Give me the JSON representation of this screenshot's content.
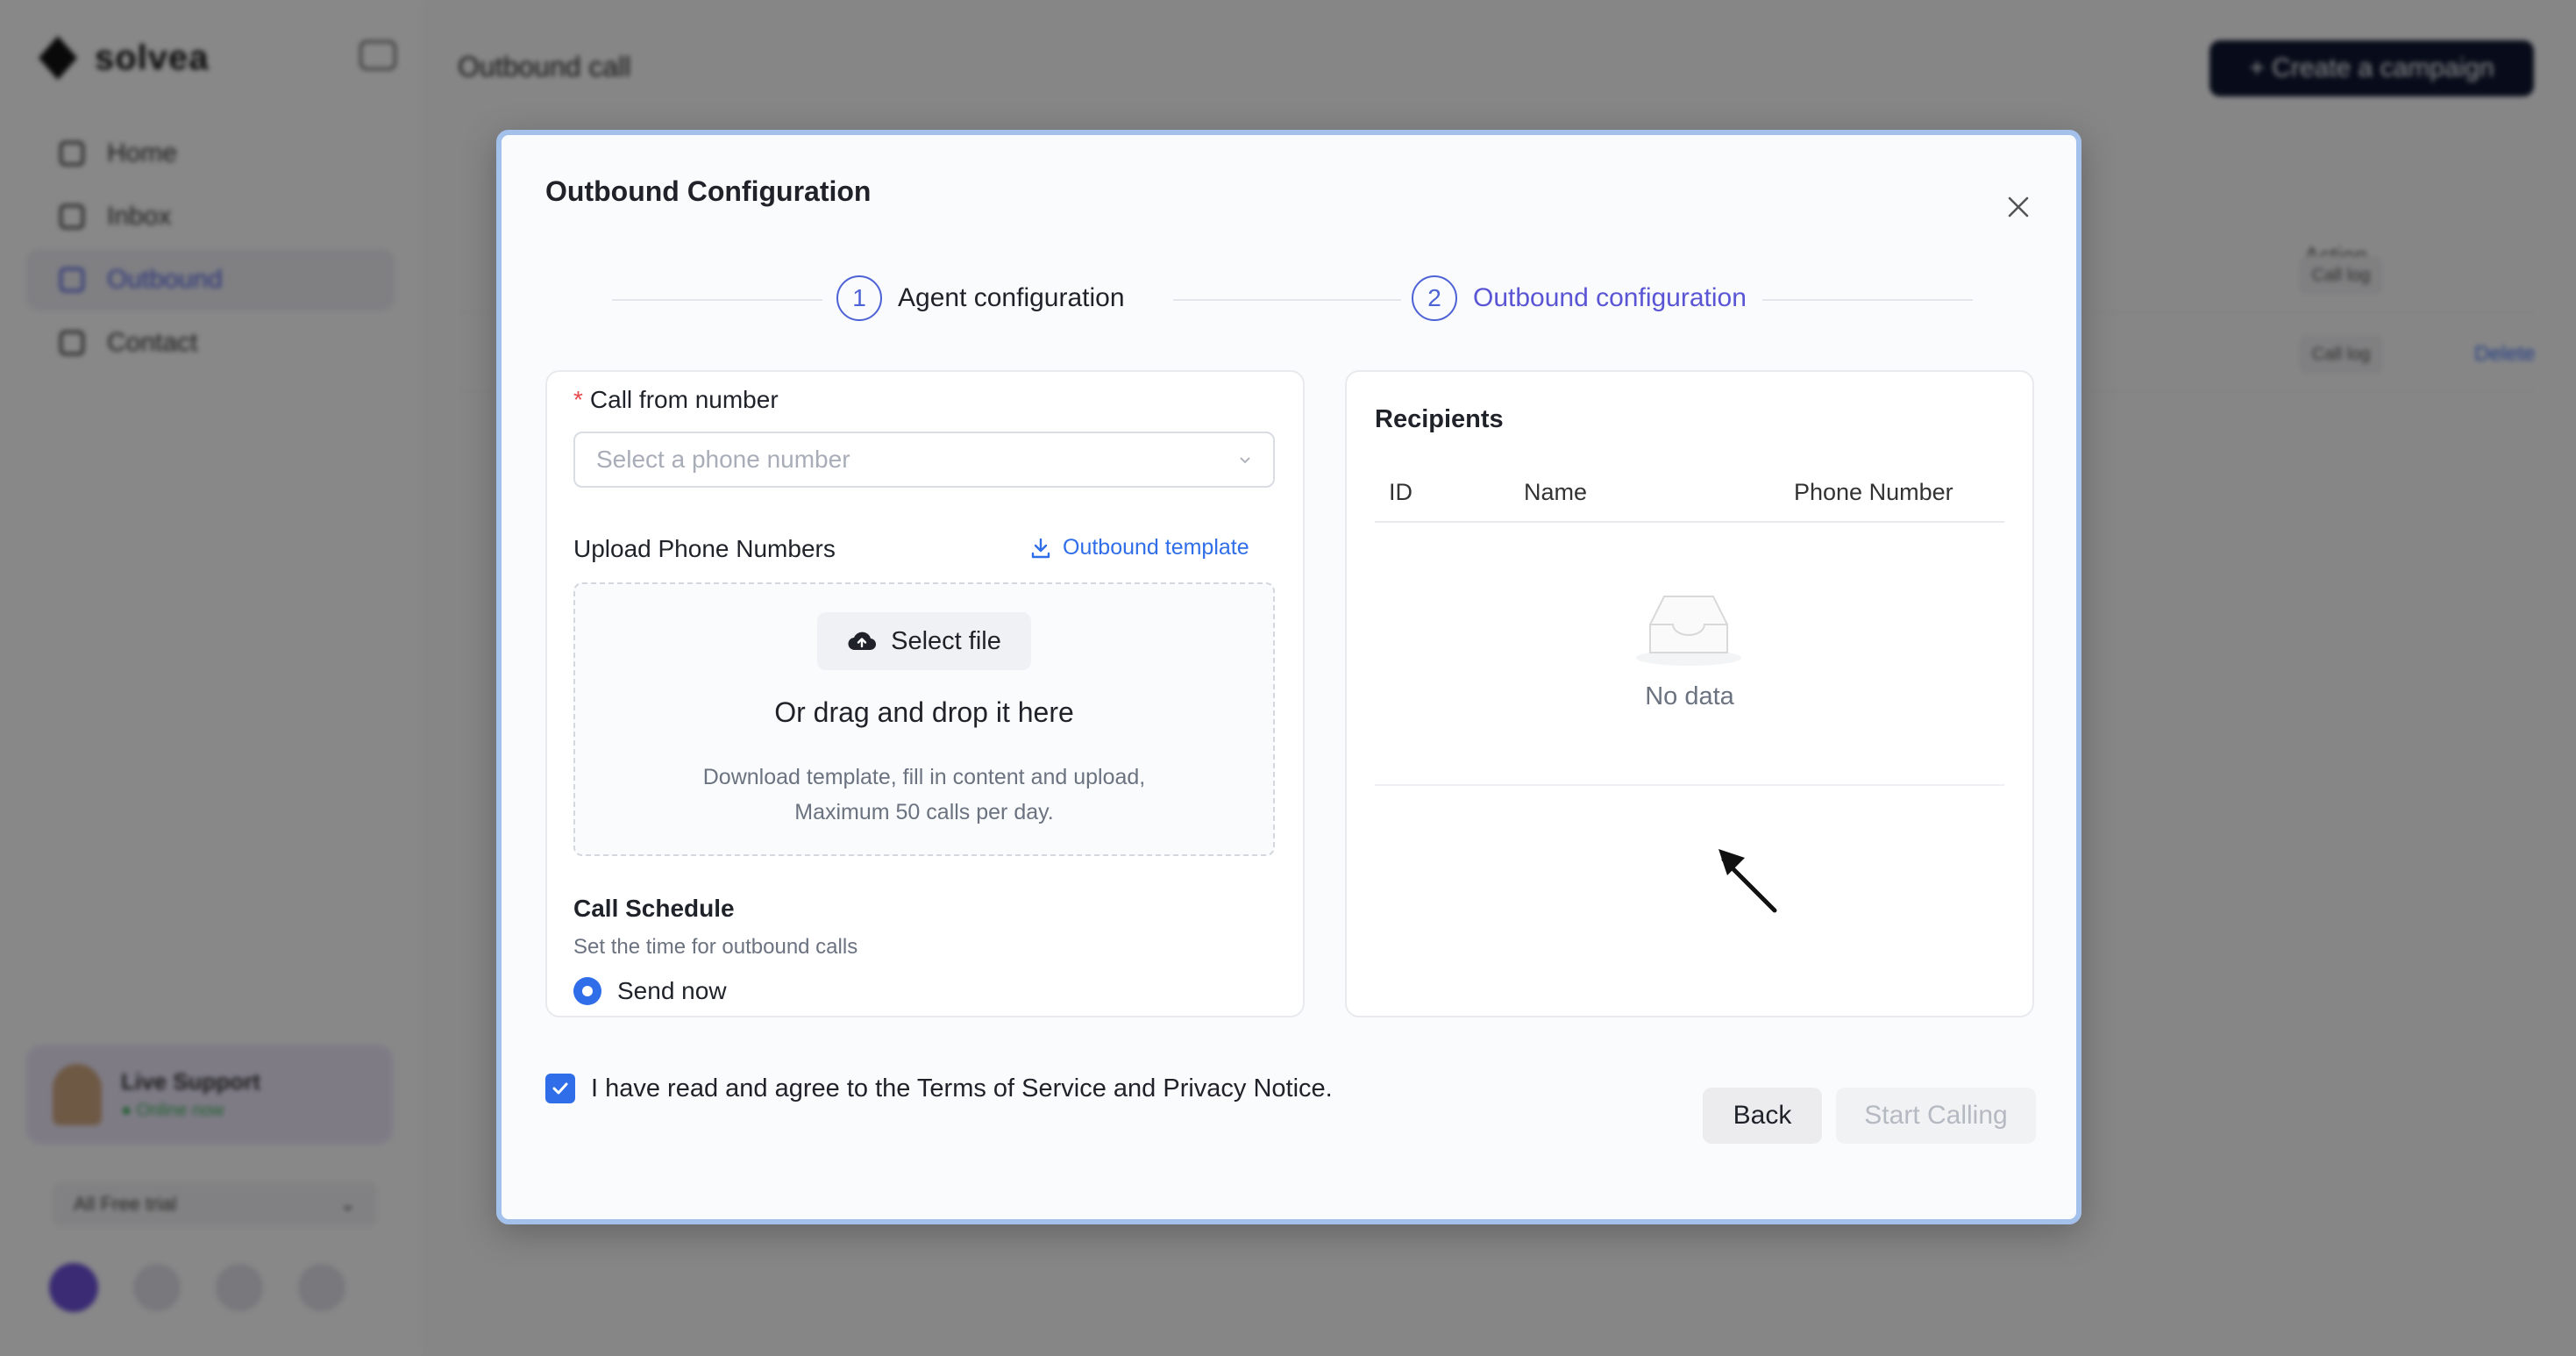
{
  "app": {
    "brand": "solvea",
    "page_title": "Outbound call",
    "create_button": "+ Create a campaign",
    "nav": [
      {
        "label": "Home",
        "active": false
      },
      {
        "label": "Inbox",
        "active": false
      },
      {
        "label": "Outbound",
        "active": true
      },
      {
        "label": "Contact",
        "active": false
      }
    ],
    "support": {
      "title": "Live Support",
      "status": "● Online now"
    },
    "plan_label": "All Free trial",
    "table_header_action": "Action",
    "rows": [
      {
        "tag": "Call log",
        "link": ""
      },
      {
        "tag": "Call log",
        "link": "Delete"
      }
    ]
  },
  "modal": {
    "title": "Outbound Configuration",
    "steps": [
      {
        "num": "1",
        "label": "Agent configuration",
        "active": false
      },
      {
        "num": "2",
        "label": "Outbound configuration",
        "active": true
      }
    ],
    "call_from": {
      "label": "Call from number",
      "placeholder": "Select a phone number"
    },
    "upload": {
      "title": "Upload Phone Numbers",
      "template_link": "Outbound template",
      "select_file": "Select file",
      "drag_text": "Or drag and drop it here",
      "hint_line1": "Download template, fill in content and upload,",
      "hint_line2": "Maximum 50 calls per day."
    },
    "schedule": {
      "title": "Call Schedule",
      "subtitle": "Set the time for outbound calls",
      "option_selected": "Send now"
    },
    "recipients": {
      "title": "Recipients",
      "columns": [
        "ID",
        "Name",
        "Phone Number"
      ],
      "empty_text": "No data"
    },
    "agree_text": "I have read and agree to the Terms of Service and Privacy Notice.",
    "agree_checked": true,
    "back_button": "Back",
    "start_button": "Start Calling"
  },
  "colors": {
    "accent": "#2f6ee8",
    "step_accent": "#4c62d6",
    "required": "#e5484d"
  }
}
